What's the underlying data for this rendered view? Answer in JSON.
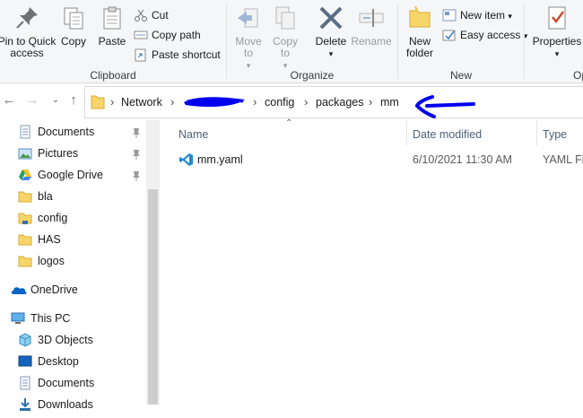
{
  "ribbon": {
    "clipboard": {
      "label": "Clipboard",
      "pin_label": "Pin to Quick access",
      "copy_label": "Copy",
      "paste_label": "Paste",
      "cut_label": "Cut",
      "copy_path_label": "Copy path",
      "paste_shortcut_label": "Paste shortcut"
    },
    "organize": {
      "label": "Organize",
      "move_to_label": "Move to",
      "copy_to_label": "Copy to",
      "delete_label": "Delete",
      "rename_label": "Rename"
    },
    "new": {
      "label": "New",
      "new_folder_label": "New folder",
      "new_item_label": "New item",
      "easy_access_label": "Easy access"
    },
    "open": {
      "label": "Op",
      "properties_label": "Properties"
    }
  },
  "address": {
    "crumbs": [
      "Network",
      "config",
      "packages",
      "mm"
    ]
  },
  "sidebar": {
    "quick_access": [
      {
        "label": "Documents",
        "icon": "documents-icon",
        "pinned": true
      },
      {
        "label": "Pictures",
        "icon": "pictures-icon",
        "pinned": true
      },
      {
        "label": "Google Drive",
        "icon": "google-drive-icon",
        "pinned": true
      },
      {
        "label": "bla",
        "icon": "folder-icon",
        "pinned": false
      },
      {
        "label": "config",
        "icon": "folder-icon",
        "pinned": false
      },
      {
        "label": "HAS",
        "icon": "folder-icon",
        "pinned": false
      },
      {
        "label": "logos",
        "icon": "folder-icon",
        "pinned": false
      }
    ],
    "onedrive": "OneDrive",
    "this_pc": "This PC",
    "pc_items": [
      {
        "label": "3D Objects",
        "icon": "3d-objects-icon"
      },
      {
        "label": "Desktop",
        "icon": "desktop-icon"
      },
      {
        "label": "Documents",
        "icon": "documents-icon"
      },
      {
        "label": "Downloads",
        "icon": "downloads-icon"
      }
    ]
  },
  "columns": {
    "name": "Name",
    "date_modified": "Date modified",
    "type": "Type"
  },
  "files": [
    {
      "name": "mm.yaml",
      "date_modified": "6/10/2021 11:30 AM",
      "type": "YAML Fil",
      "icon": "vscode-icon"
    }
  ],
  "colors": {
    "accent": "#0078d7",
    "annotation": "#0000ee",
    "folder": "#f8d568"
  }
}
